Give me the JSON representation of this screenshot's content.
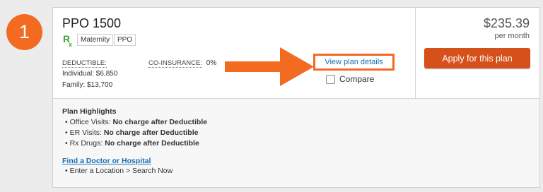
{
  "step_number": "1",
  "plan": {
    "name": "PPO 1500",
    "rx_icon": "rx-prescription-icon",
    "tags": [
      "Maternity",
      "PPO"
    ],
    "deductible_label": "DEDUCTIBLE:",
    "deductible_individual": "Individual: $6,850",
    "deductible_family": "Family: $13,700",
    "coinsurance_label": "CO-INSURANCE:",
    "coinsurance_value": "0%"
  },
  "actions": {
    "view_details": "View plan details",
    "compare": "Compare",
    "apply": "Apply for this plan"
  },
  "pricing": {
    "price": "$235.39",
    "period": "per month"
  },
  "highlights": {
    "title": "Plan Highlights",
    "items": [
      {
        "key": "Office Visits:",
        "value": "No charge after Deductible"
      },
      {
        "key": "ER Visits:",
        "value": "No charge after Deductible"
      },
      {
        "key": "Rx Drugs:",
        "value": "No charge after Deductible"
      }
    ]
  },
  "doctor": {
    "link": "Find a Doctor or Hospital",
    "hint": "Enter a Location > Search Now"
  },
  "colors": {
    "accent_orange": "#f26b21",
    "apply_button": "#d5501a",
    "link_blue": "#1a6fb3",
    "rx_green": "#3aa935"
  }
}
